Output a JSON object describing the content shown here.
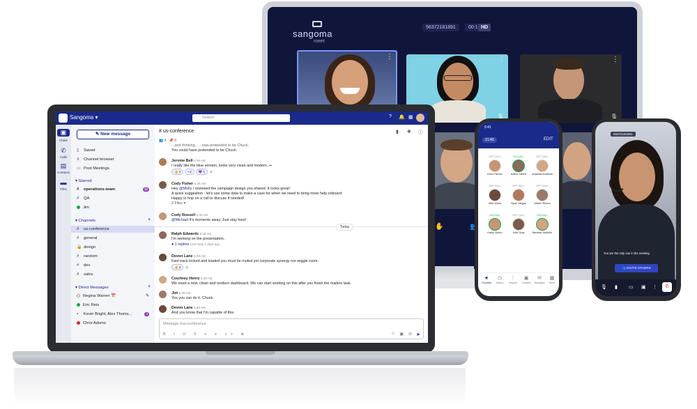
{
  "meet": {
    "logo": "sangoma",
    "logo_sub": "meet",
    "meeting_id": "56372181891",
    "elapsed": "00:15",
    "quality": "HD"
  },
  "app": {
    "brand": "Sangoma",
    "search_placeholder": "Search"
  },
  "rail": {
    "items": [
      {
        "label": "Chats",
        "icon": "chat-icon"
      },
      {
        "label": "Calls",
        "icon": "phone-icon"
      },
      {
        "label": "Contacts",
        "icon": "contacts-icon"
      },
      {
        "label": "Files",
        "icon": "folder-icon"
      }
    ]
  },
  "sidebar": {
    "new_message": "New message",
    "quick": [
      "Saved",
      "Channel browser",
      "Post Meetings"
    ],
    "starred_label": "Starred",
    "starred": [
      {
        "name": "operations-team",
        "badge": "12"
      },
      {
        "name": "QA"
      },
      {
        "name": "Jim"
      }
    ],
    "channels_label": "Channels",
    "channels": [
      "us-conference",
      "general",
      "design",
      "random",
      "dev",
      "sales"
    ],
    "dm_label": "Direct Messages",
    "dms": [
      {
        "name": "Regina Warren 📅"
      },
      {
        "name": "Eric Reis"
      },
      {
        "name": "Kevin Bright, Alex Thoms...",
        "badge": "3"
      },
      {
        "name": "Chris Adoms"
      }
    ]
  },
  "channel": {
    "title": "us-conference",
    "members": "4",
    "pins": "0",
    "partial_top": "...and thinking... ...was pretended to be Chuck.",
    "partial_top2": "You could have pretended to be Chuck.",
    "messages": [
      {
        "name": "Jerome Bell",
        "time": "6:39 AM",
        "text": "I really like the blue version, looks very clean and modern. ••",
        "reactions": [
          "👍 2",
          "• 2",
          "💜 1"
        ]
      },
      {
        "name": "Cody Fisher",
        "time": "6:39 AM",
        "text_pre": "Hey ",
        "mention": "@Molly",
        "text": " I reviewed the campaign design you shared. It looks great!",
        "lines": [
          "A quick suggestion - let's use some data to make a case for when we need to bring more help onboard.",
          "Happy to hop on a call to discuss if needed!"
        ],
        "files": "2 Files"
      },
      {
        "name": "Cody Russell",
        "time": "6:39 AM",
        "mention": "@Michael",
        "text": " It's moments away. Just stay here!"
      },
      {
        "name": "Ralph Edwards",
        "time": "6:39 AM",
        "text": "I'm working on the presentation.",
        "replies": "1 replies",
        "reply_meta": "Last reply 2 days ago"
      },
      {
        "name": "Devon Lane",
        "time": "6:39 AM",
        "text": "Fast track locked and loaded you must be muted yet corporate synergy nor wiggle room.",
        "reactions": [
          "👍 3"
        ]
      },
      {
        "name": "Courtney Henry",
        "time": "6:39 AM",
        "text": "We need a new, clean and modern dashboard. We can start working on this after you finish the mailers task."
      },
      {
        "name": "Jim",
        "time": "6:39 AM",
        "text": "Yes you can do it, Chuck."
      },
      {
        "name": "Devon Lane",
        "time": "6:39 AM",
        "text": "And you know that I'm capable of this."
      }
    ],
    "divider": "Today",
    "composer_placeholder": "Message #us-conference"
  },
  "phone1": {
    "time": "9:41",
    "chip": "21:40",
    "edit": "EDIT",
    "contacts": [
      {
        "status": "OFF CALL",
        "name": "Dora Parmer",
        "on": false
      },
      {
        "status": "ON CALL",
        "name": "Adam Gilbert",
        "on": true
      },
      {
        "status": "OFF CALL",
        "name": "Amanda Andrews",
        "on": false
      },
      {
        "status": "OFF CALL",
        "name": "Nick Wood",
        "on": false
      },
      {
        "status": "OFF CALL",
        "name": "Ryan Vargas",
        "on": false
      },
      {
        "status": "OFF CALL",
        "name": "Allwen Rivera",
        "on": false
      },
      {
        "status": "ON CALL",
        "name": "Kathy Green",
        "on": true
      },
      {
        "status": "OFF CALL",
        "name": "Julie Gray",
        "on": false
      },
      {
        "status": "ON CALL",
        "name": "Barbara Jackson",
        "on": true
      }
    ],
    "tabs": [
      "Favorites",
      "History",
      "Keypad",
      "Contacts",
      "Messages",
      "More"
    ]
  },
  "phone2": {
    "meeting_id": "56372181891",
    "hint": "You are the only one in the meeting",
    "invite": "INVITE OTHERS"
  }
}
